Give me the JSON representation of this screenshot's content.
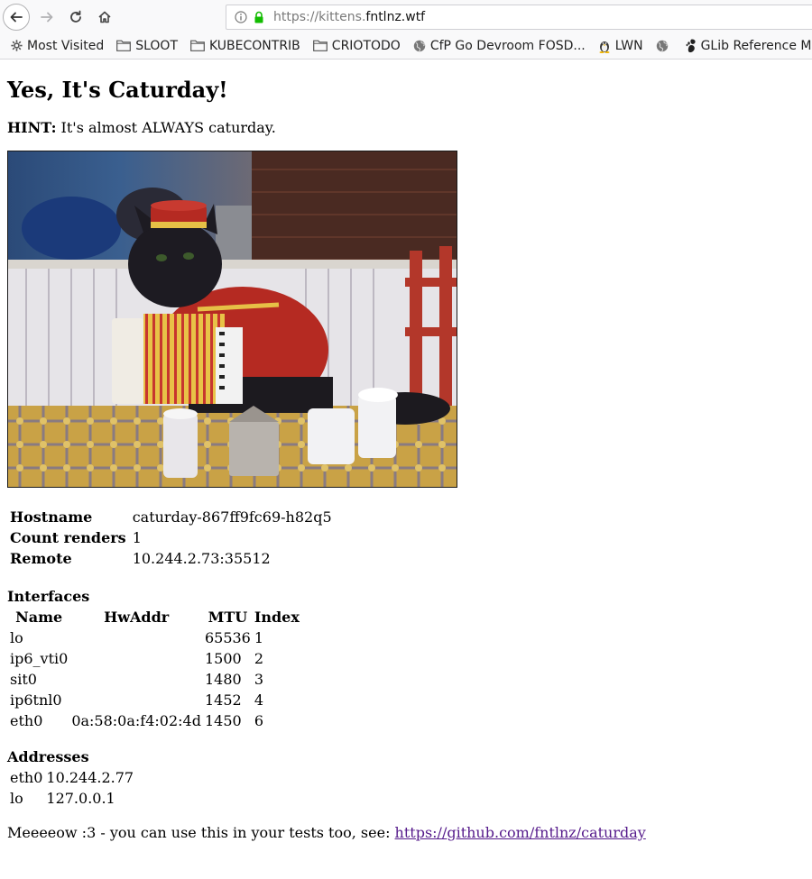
{
  "browser": {
    "url_prefix": "https://kittens.",
    "url_domain": "fntlnz.wtf",
    "bookmarks": [
      {
        "label": "Most Visited",
        "icon": "gear-icon"
      },
      {
        "label": "SLOOT",
        "icon": "folder-icon"
      },
      {
        "label": "KUBECONTRIB",
        "icon": "folder-icon"
      },
      {
        "label": "CRIOTODO",
        "icon": "folder-icon"
      },
      {
        "label": "CfP Go Devroom FOSD...",
        "icon": "globe-icon"
      },
      {
        "label": "LWN",
        "icon": "tux-icon"
      },
      {
        "label": "",
        "icon": "globe-icon"
      },
      {
        "label": "GLib Reference Manual...",
        "icon": "gnome-icon"
      }
    ]
  },
  "page": {
    "title": "Yes, It's Caturday!",
    "hint_label": "HINT:",
    "hint_text": " It's almost ALWAYS caturday.",
    "info": [
      {
        "key": "Hostname",
        "value": "caturday-867ff9fc69-h82q5"
      },
      {
        "key": "Count renders",
        "value": "1"
      },
      {
        "key": "Remote",
        "value": "10.244.2.73:35512"
      }
    ],
    "interfaces_heading": "Interfaces",
    "interfaces_headers": [
      "Name",
      "HwAddr",
      "MTU",
      "Index"
    ],
    "interfaces": [
      [
        "lo",
        "",
        "65536",
        "1"
      ],
      [
        "ip6_vti0",
        "",
        "1500",
        "2"
      ],
      [
        "sit0",
        "",
        "1480",
        "3"
      ],
      [
        "ip6tnl0",
        "",
        "1452",
        "4"
      ],
      [
        "eth0",
        "0a:58:0a:f4:02:4d",
        "1450",
        "6"
      ]
    ],
    "addresses_heading": "Addresses",
    "addresses": [
      [
        "eth0",
        "10.244.2.77"
      ],
      [
        "lo",
        "127.0.0.1"
      ]
    ],
    "footer_text": "Meeeeow :3 - you can use this in your tests too, see: ",
    "footer_link": "https://github.com/fntlnz/caturday"
  }
}
